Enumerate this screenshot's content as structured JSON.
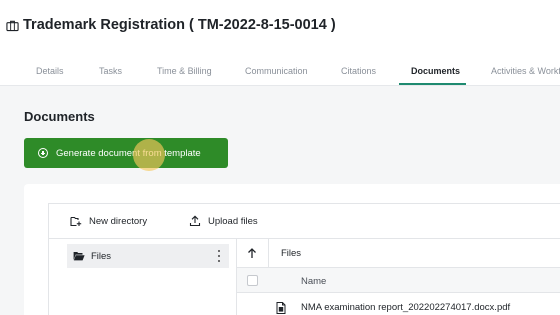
{
  "header": {
    "icon": "briefcase-icon",
    "title": "Trademark Registration ( TM-2022-8-15-0014 )"
  },
  "tabs": [
    {
      "label": "Details",
      "active": false
    },
    {
      "label": "Tasks",
      "active": false
    },
    {
      "label": "Time & Billing",
      "active": false
    },
    {
      "label": "Communication",
      "active": false
    },
    {
      "label": "Citations",
      "active": false
    },
    {
      "label": "Documents",
      "active": true
    },
    {
      "label": "Activities & Workfl",
      "active": false
    }
  ],
  "documents": {
    "title": "Documents",
    "generate_button": {
      "icon": "plus-circle-icon",
      "label": "Generate document from template"
    }
  },
  "explorer": {
    "toolbar": {
      "new_directory": {
        "icon": "folder-plus-icon",
        "label": "New directory"
      },
      "upload_files": {
        "icon": "upload-icon",
        "label": "Upload files"
      }
    },
    "tree": [
      {
        "icon": "folder-open-icon",
        "label": "Files",
        "selected": true
      }
    ],
    "path": {
      "up_icon": "arrow-up-icon",
      "current": "Files"
    },
    "table": {
      "columns": [
        "Name"
      ],
      "rows": [
        {
          "icon": "pdf-file-icon",
          "name": "NMA examination report_202202274017.docx.pdf"
        }
      ]
    }
  },
  "colors": {
    "primary_button": "#2e8b28",
    "active_tab_underline": "#1f8a70",
    "cursor_highlight": "#f5c85a"
  }
}
